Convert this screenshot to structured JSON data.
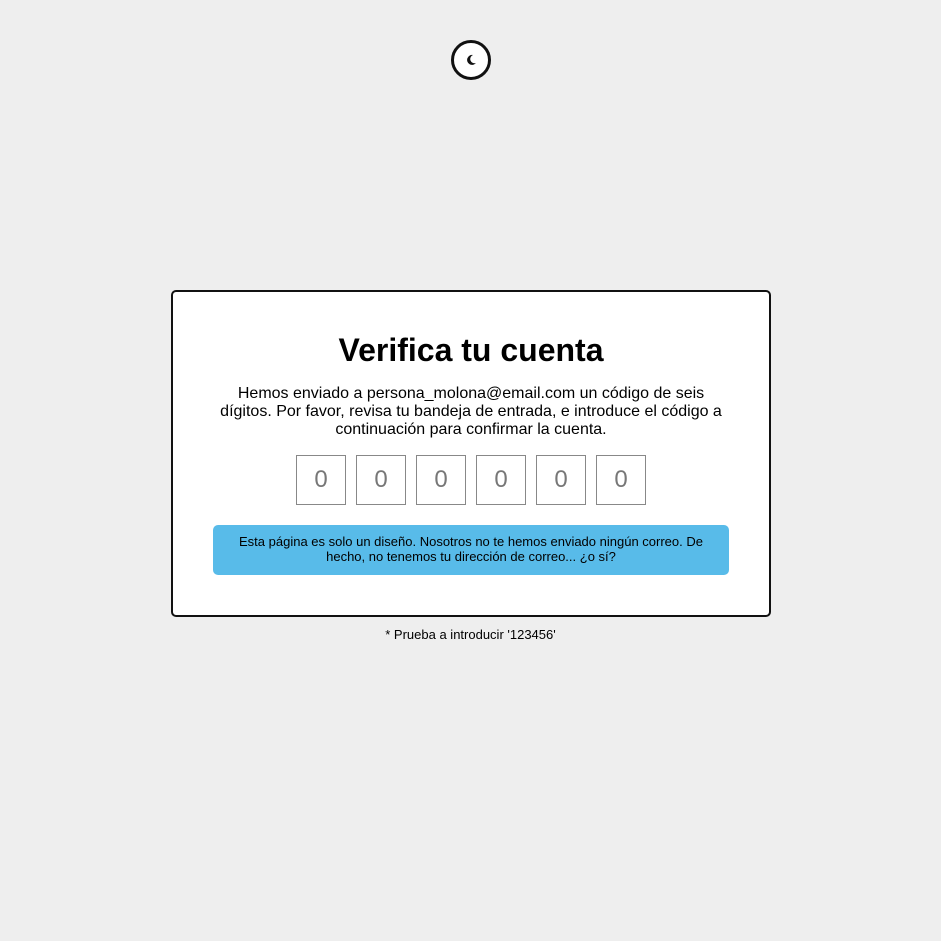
{
  "theme_toggle": {
    "icon": "moon-icon"
  },
  "card": {
    "title": "Verifica tu cuenta",
    "message": "Hemos enviado a persona_molona@email.com un código de seis dígitos. Por favor, revisa tu bandeja de entrada, e introduce el código a continuación para confirmar la cuenta.",
    "code_digits": [
      {
        "placeholder": "0",
        "value": ""
      },
      {
        "placeholder": "0",
        "value": ""
      },
      {
        "placeholder": "0",
        "value": ""
      },
      {
        "placeholder": "0",
        "value": ""
      },
      {
        "placeholder": "0",
        "value": ""
      },
      {
        "placeholder": "0",
        "value": ""
      }
    ],
    "notice": "Esta página es solo un diseño. Nosotros no te hemos enviado ningún correo. De hecho, no tenemos tu dirección de correo... ¿o sí?"
  },
  "hint": "* Prueba a introducir '123456'",
  "colors": {
    "background": "#eeeeee",
    "card": "#ffffff",
    "notice": "#58bbe9",
    "border": "#111111"
  }
}
